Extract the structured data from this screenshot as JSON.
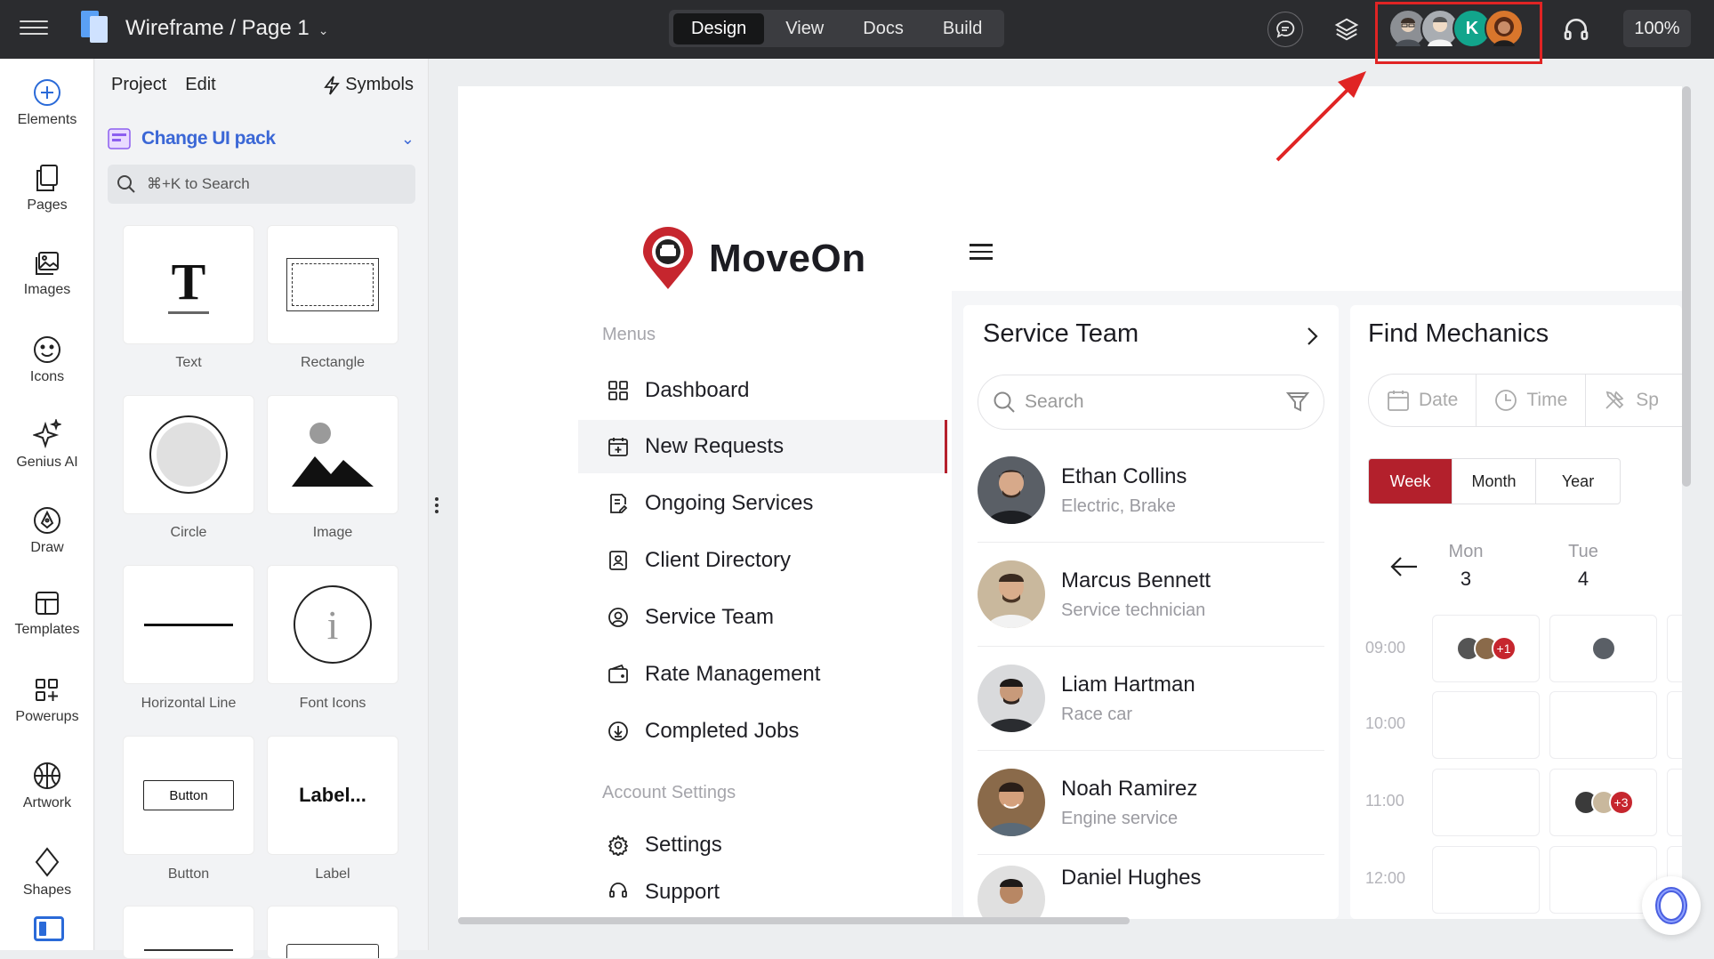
{
  "topbar": {
    "file_title": "Wireframe / Page 1",
    "mode_tabs": [
      "Design",
      "View",
      "Docs",
      "Build"
    ],
    "active_mode": "Design",
    "collaborator_initial": "K",
    "zoom": "100%"
  },
  "rail": {
    "items": [
      "Elements",
      "Pages",
      "Images",
      "Icons",
      "Genius AI",
      "Draw",
      "Templates",
      "Powerups",
      "Artwork",
      "Shapes"
    ]
  },
  "panel": {
    "tabs": [
      "Project",
      "Edit"
    ],
    "symbols_label": "Symbols",
    "ui_pack_label": "Change UI pack",
    "search_placeholder": "⌘+K to Search",
    "tiles": [
      "Text",
      "Rectangle",
      "Circle",
      "Image",
      "Horizontal Line",
      "Font Icons",
      "Button",
      "Label"
    ],
    "button_preview": "Button",
    "label_preview": "Label..."
  },
  "app": {
    "brand": "MoveOn",
    "menus_heading": "Menus",
    "nav": [
      "Dashboard",
      "New Requests",
      "Ongoing Services",
      "Client Directory",
      "Service Team",
      "Rate Management",
      "Completed Jobs"
    ],
    "active_nav": "New Requests",
    "account_heading": "Account Settings",
    "account_nav": [
      "Settings",
      "Support"
    ]
  },
  "service_team": {
    "title": "Service Team",
    "search_placeholder": "Search",
    "members": [
      {
        "name": "Ethan Collins",
        "role": "Electric, Brake"
      },
      {
        "name": "Marcus Bennett",
        "role": "Service technician"
      },
      {
        "name": "Liam Hartman",
        "role": "Race car"
      },
      {
        "name": "Noah Ramirez",
        "role": "Engine service"
      },
      {
        "name": "Daniel Hughes",
        "role": ""
      }
    ]
  },
  "find_mechanics": {
    "title": "Find Mechanics",
    "filters": [
      "Date",
      "Time",
      "Sp"
    ],
    "views": [
      "Week",
      "Month",
      "Year"
    ],
    "active_view": "Week",
    "days": [
      {
        "name": "Mon",
        "date": "3"
      },
      {
        "name": "Tue",
        "date": "4"
      }
    ],
    "times": [
      "09:00",
      "10:00",
      "11:00",
      "12:00"
    ],
    "extra_counts": [
      "+1",
      "+3"
    ]
  },
  "colors": {
    "accent": "#b3202c",
    "brand_blue": "#3b67d6",
    "highlight": "#e02424"
  }
}
